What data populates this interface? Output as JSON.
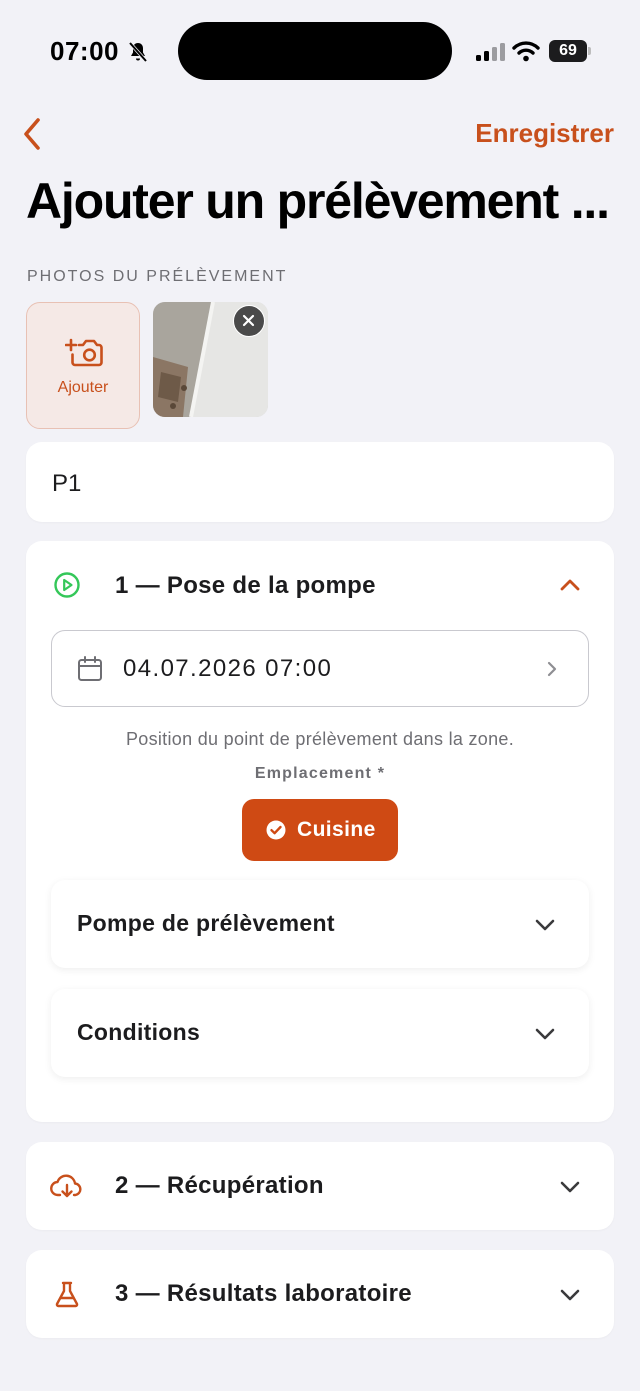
{
  "status_bar": {
    "time": "07:00",
    "battery": "69"
  },
  "nav": {
    "save_label": "Enregistrer",
    "title": "Ajouter un prélèvement ..."
  },
  "photos": {
    "section_label": "PHOTOS DU PRÉLÈVEMENT",
    "add_label": "Ajouter"
  },
  "name_field": {
    "value": "P1"
  },
  "step1": {
    "title": "1 — Pose de la pompe",
    "expanded": true,
    "date_value": "04.07.2026  07:00",
    "hint": "Position du point de prélèvement dans la zone.",
    "location_label": "Emplacement *",
    "location_chip": "Cuisine",
    "subsections": [
      "Pompe de prélèvement",
      "Conditions"
    ]
  },
  "step2": {
    "title": "2 — Récupération"
  },
  "step3": {
    "title": "3 — Résultats laboratoire"
  },
  "colors": {
    "accent": "#c8501c",
    "chip": "#cf4a14",
    "success": "#34c759",
    "background": "#f2f2f7"
  },
  "icons": {
    "step1": "play-circle-icon",
    "step2": "cloud-download-icon",
    "step3": "flask-icon",
    "date": "calendar-icon",
    "add_photo": "camera-plus-icon"
  }
}
